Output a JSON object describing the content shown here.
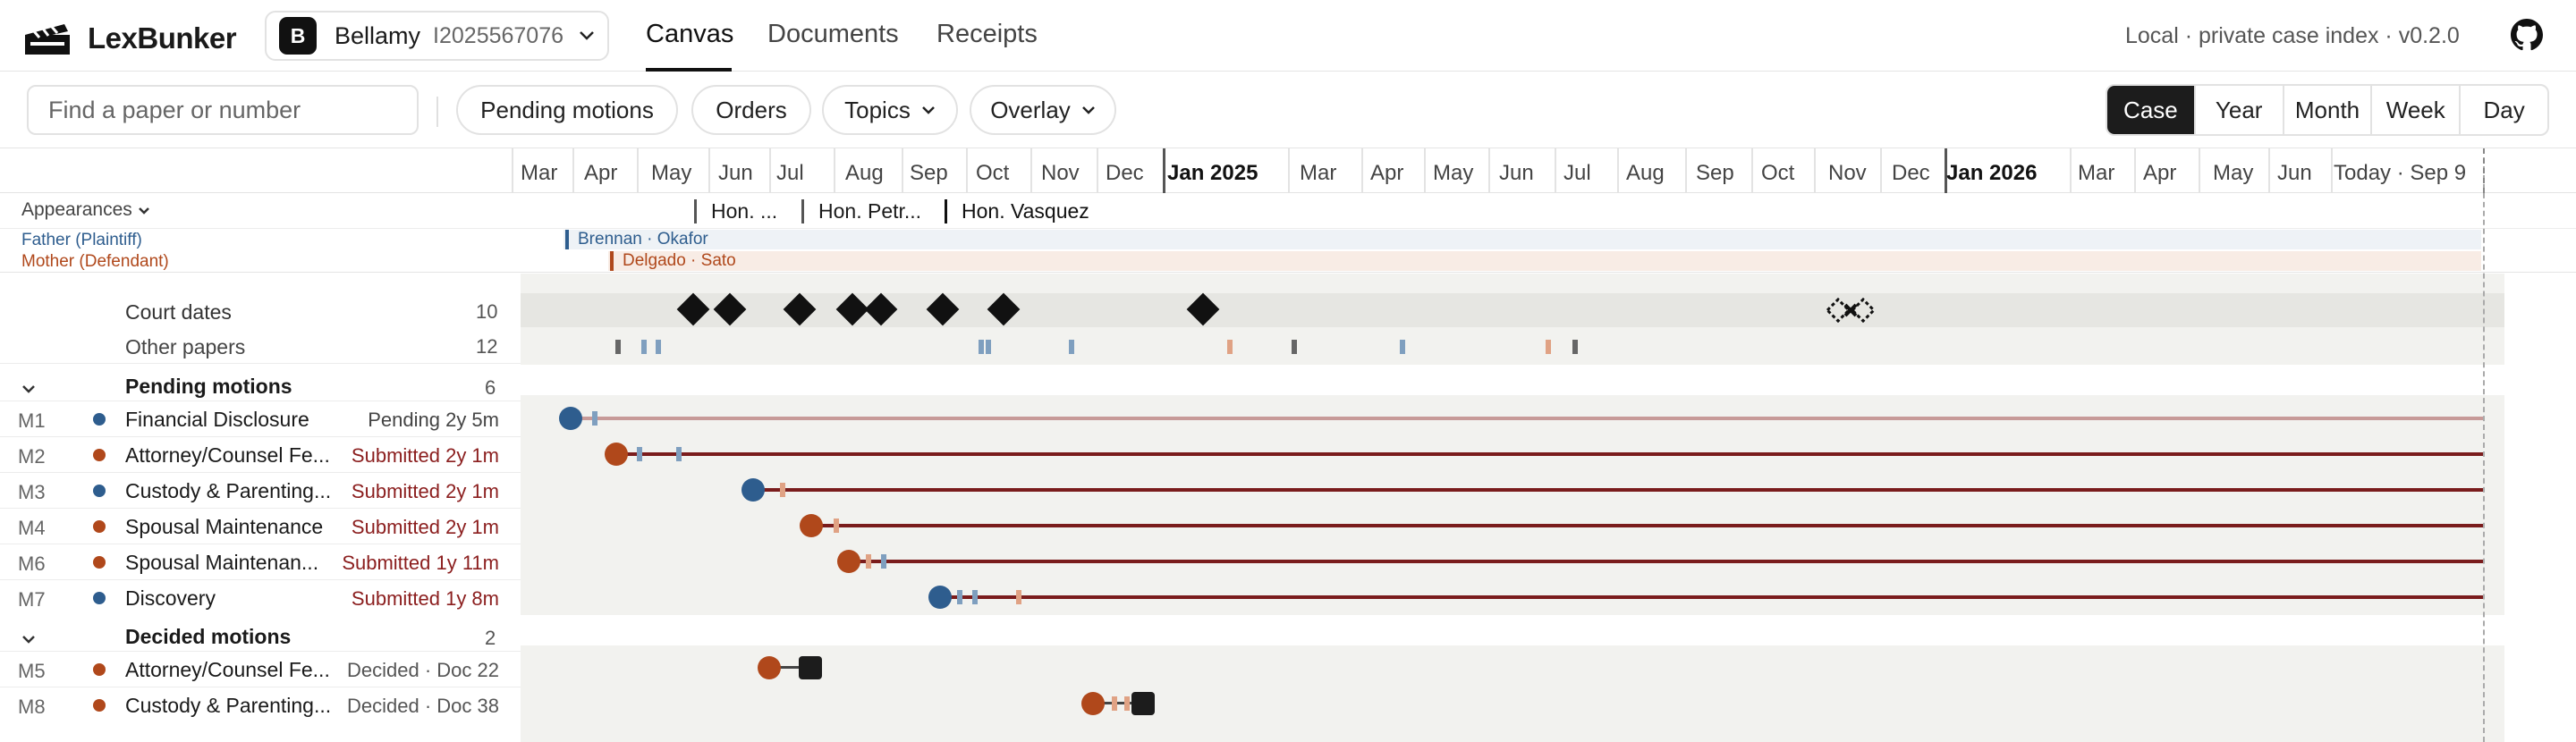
{
  "app": {
    "name": "LexBunker",
    "version": "Local · private case index · v0.2.0"
  },
  "case": {
    "badge": "B",
    "name": "Bellamy",
    "number": "I2025567076"
  },
  "nav": {
    "tabs": [
      "Canvas",
      "Documents",
      "Receipts"
    ],
    "active": "Canvas"
  },
  "toolbar": {
    "search_placeholder": "Find a paper or number",
    "chips": [
      "Pending motions",
      "Orders",
      "Topics",
      "Overlay"
    ],
    "scale": [
      "Case",
      "Year",
      "Month",
      "Week",
      "Day"
    ],
    "scale_active": "Case"
  },
  "axis": {
    "ticks": [
      "Mar",
      "Apr",
      "May",
      "Jun",
      "Jul",
      "Aug",
      "Sep",
      "Oct",
      "Nov",
      "Dec",
      "Jan 2025",
      "Mar",
      "Apr",
      "May",
      "Jun",
      "Jul",
      "Aug",
      "Sep",
      "Oct",
      "Nov",
      "Dec",
      "Jan 2026",
      "Mar",
      "Apr",
      "May",
      "Jun",
      "Today · Sep 9"
    ]
  },
  "appearances": {
    "label": "Appearances",
    "judges": [
      "Hon. ...",
      "Hon. Petr...",
      "Hon. Vasquez"
    ]
  },
  "parties": [
    {
      "role": "Father (Plaintiff)",
      "counsel": "Brennan · Okafor",
      "color": "#2e5d8e"
    },
    {
      "role": "Mother (Defendant)",
      "counsel": "Delgado · Sato",
      "color": "#b0481b"
    }
  ],
  "summary_rows": [
    {
      "label": "Court dates",
      "count": "10"
    },
    {
      "label": "Other papers",
      "count": "12"
    }
  ],
  "groups": [
    {
      "title": "Pending motions",
      "count": "6",
      "motions": [
        {
          "id": "M1",
          "title": "Financial Disclosure",
          "status": "Pending 2y 5m",
          "party_color": "#2e5d8e",
          "status_color": "#444"
        },
        {
          "id": "M2",
          "title": "Attorney/Counsel Fe...",
          "status": "Submitted 2y 1m",
          "party_color": "#b0481b",
          "status_color": "#8b1e1e"
        },
        {
          "id": "M3",
          "title": "Custody & Parenting...",
          "status": "Submitted 2y 1m",
          "party_color": "#2e5d8e",
          "status_color": "#8b1e1e"
        },
        {
          "id": "M4",
          "title": "Spousal Maintenance",
          "status": "Submitted 2y 1m",
          "party_color": "#b0481b",
          "status_color": "#8b1e1e"
        },
        {
          "id": "M6",
          "title": "Spousal Maintenan...",
          "status": "Submitted 1y 11m",
          "party_color": "#b0481b",
          "status_color": "#8b1e1e"
        },
        {
          "id": "M7",
          "title": "Discovery",
          "status": "Submitted 1y 8m",
          "party_color": "#2e5d8e",
          "status_color": "#8b1e1e"
        }
      ]
    },
    {
      "title": "Decided motions",
      "count": "2",
      "motions": [
        {
          "id": "M5",
          "title": "Attorney/Counsel Fe...",
          "status": "Decided · Doc 22",
          "party_color": "#b0481b",
          "status_color": "#555"
        },
        {
          "id": "M8",
          "title": "Custody & Parenting...",
          "status": "Decided · Doc 38",
          "party_color": "#b0481b",
          "status_color": "#555"
        }
      ]
    }
  ]
}
